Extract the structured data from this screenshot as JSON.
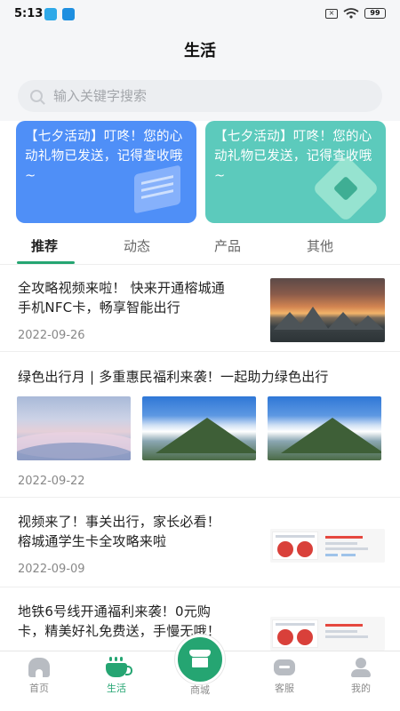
{
  "status_bar": {
    "time": "5:13",
    "battery": "99"
  },
  "header": {
    "title": "生活"
  },
  "search": {
    "placeholder": "输入关键字搜索"
  },
  "banners": [
    {
      "text": "【七夕活动】叮咚！您的心动礼物已发送，记得查收哦~",
      "color": "#4f8ff7"
    },
    {
      "text": "【七夕活动】叮咚！您的心动礼物已发送，记得查收哦~",
      "color": "#5ccabc"
    }
  ],
  "tabs": [
    {
      "label": "推荐",
      "active": true
    },
    {
      "label": "动态",
      "active": false
    },
    {
      "label": "产品",
      "active": false
    },
    {
      "label": "其他",
      "active": false
    }
  ],
  "articles": [
    {
      "title_lines": [
        "全攻略视频来啦！ 快来开通榕城通",
        "手机NFC卡，畅享智能出行"
      ],
      "date": "2022-09-26"
    },
    {
      "title_lines": [
        "绿色出行月 | 多重惠民福利来袭！一起助力绿色出行"
      ],
      "date": "2022-09-22"
    },
    {
      "title_lines": [
        "视频来了！事关出行，家长必看！",
        "榕城通学生卡全攻略来啦"
      ],
      "date": "2022-09-09"
    },
    {
      "title_lines": [
        "地铁6号线开通福利来袭！0元购",
        "卡，精美好礼免费送，手慢无哦！"
      ],
      "date": ""
    }
  ],
  "bottom_nav": {
    "home": "首页",
    "life": "生活",
    "shop": "商城",
    "service": "客服",
    "me": "我的"
  },
  "colors": {
    "accent": "#25a572",
    "banner_blue": "#4f8ff7",
    "banner_teal": "#5ccabc"
  }
}
